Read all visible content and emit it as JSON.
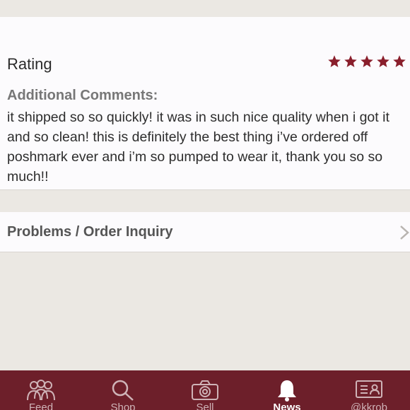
{
  "rating": {
    "title": "Rating",
    "stars": 5,
    "star_color": "#8a1f2c"
  },
  "comments": {
    "label": "Additional Comments:",
    "text": "it shipped so so quickly! it was in such nice quality when i got it and so clean! this is definitely the best thing i’ve ordered off poshmark ever and i’m so pumped to wear it, thank you so so much!!"
  },
  "problems": {
    "label": "Problems / Order Inquiry",
    "chevron_icon": "chevron-right-icon"
  },
  "tabbar": {
    "background": "#6d1f2a",
    "tabs": [
      {
        "label": "Feed",
        "icon": "people-icon",
        "active": false
      },
      {
        "label": "Shop",
        "icon": "search-icon",
        "active": false
      },
      {
        "label": "Sell",
        "icon": "camera-icon",
        "active": false
      },
      {
        "label": "News",
        "icon": "bell-icon",
        "active": true
      },
      {
        "label": "@kkrob",
        "icon": "profile-card-icon",
        "active": false
      }
    ]
  }
}
